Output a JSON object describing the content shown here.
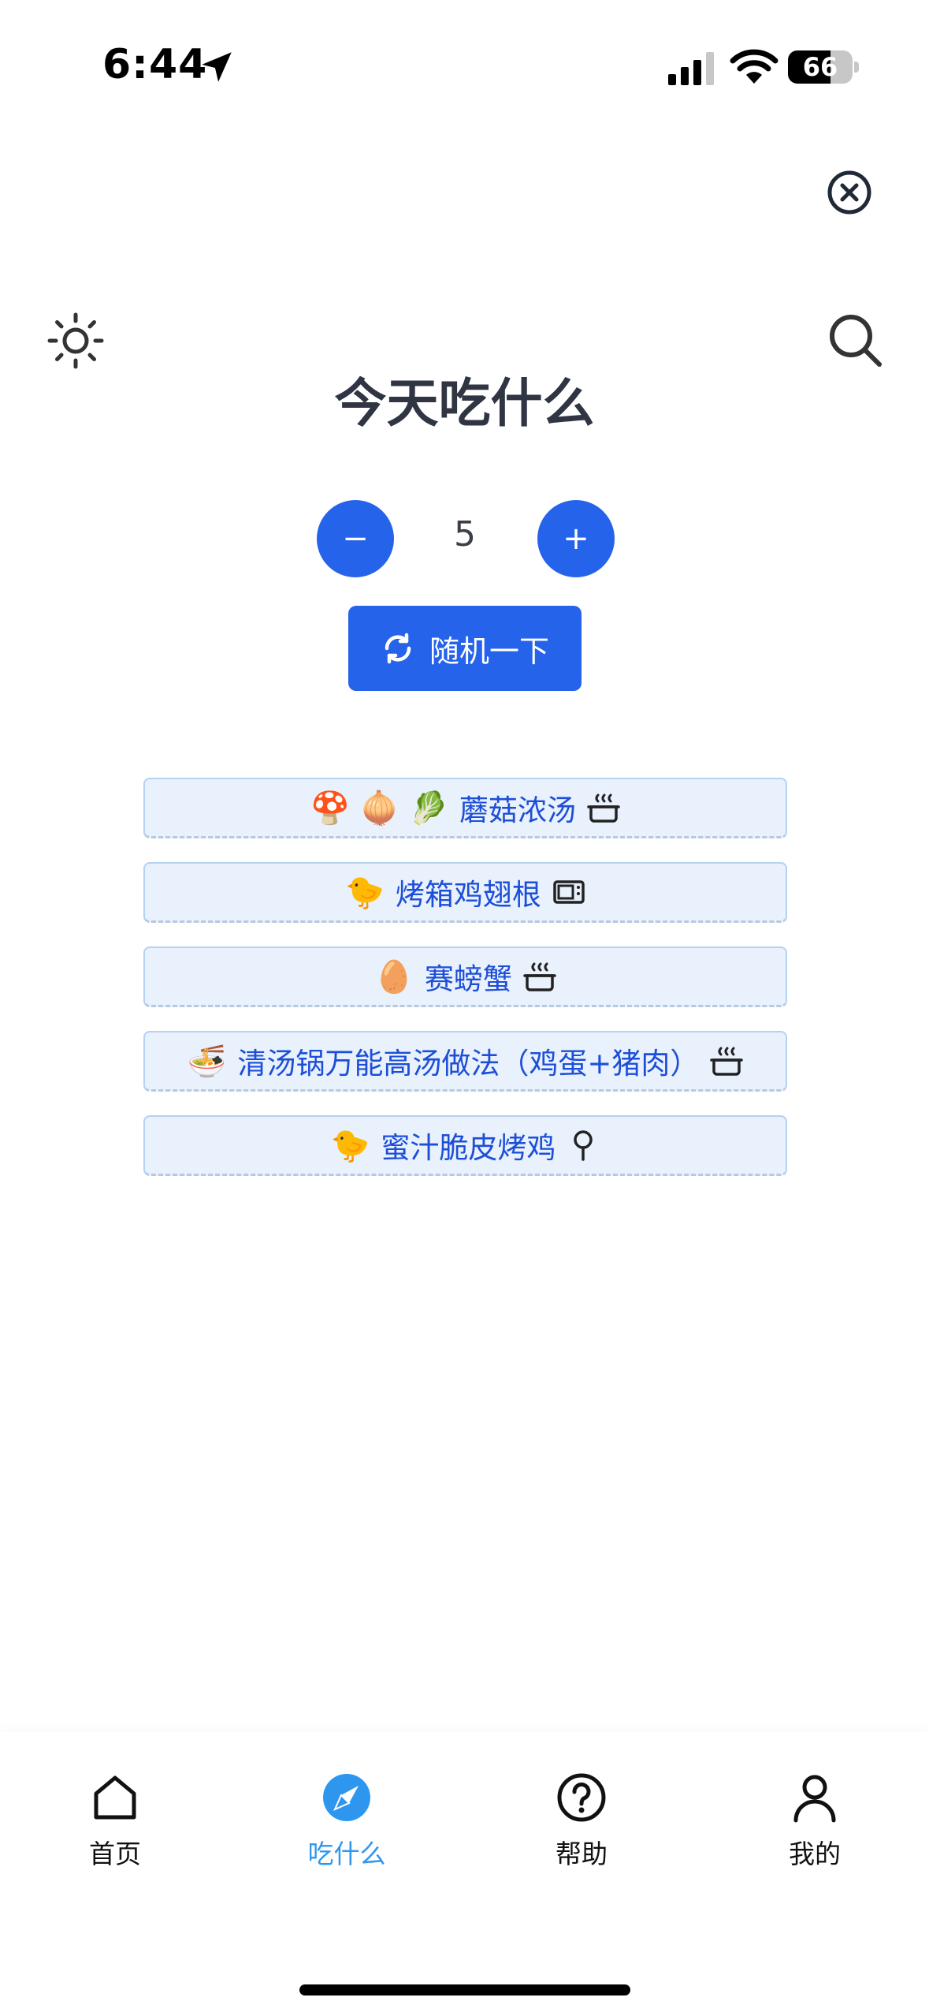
{
  "status": {
    "time": "6:44",
    "battery": "66",
    "battery_level": 0.66
  },
  "header": {
    "title": "今天吃什么"
  },
  "counter": {
    "minus_label": "−",
    "plus_label": "+",
    "value": "5"
  },
  "random_button": {
    "label": "随机一下",
    "icon": "refresh-icon"
  },
  "dishes": [
    {
      "emoji": "🍄 🧅 🥬",
      "name": "蘑菇浓汤",
      "tool": "pot-icon"
    },
    {
      "emoji": "🐤",
      "name": "烤箱鸡翅根",
      "tool": "oven-icon"
    },
    {
      "emoji": "🥚",
      "name": "赛螃蟹",
      "tool": "pot-icon"
    },
    {
      "emoji": "🍜",
      "name": "清汤锅万能高汤做法（鸡蛋+猪肉）",
      "tool": "pot-icon"
    },
    {
      "emoji": "🐤",
      "name": "蜜汁脆皮烤鸡",
      "tool": "pan-icon"
    }
  ],
  "tabs": [
    {
      "label": "首页",
      "icon": "home-icon",
      "active": false
    },
    {
      "label": "吃什么",
      "icon": "compass-icon",
      "active": true
    },
    {
      "label": "帮助",
      "icon": "help-icon",
      "active": false
    },
    {
      "label": "我的",
      "icon": "user-icon",
      "active": false
    }
  ],
  "colors": {
    "accent": "#2563eb",
    "active_tab": "#2f96ef",
    "item_bg": "#e8f1fc",
    "item_text": "#1d4ed8"
  }
}
